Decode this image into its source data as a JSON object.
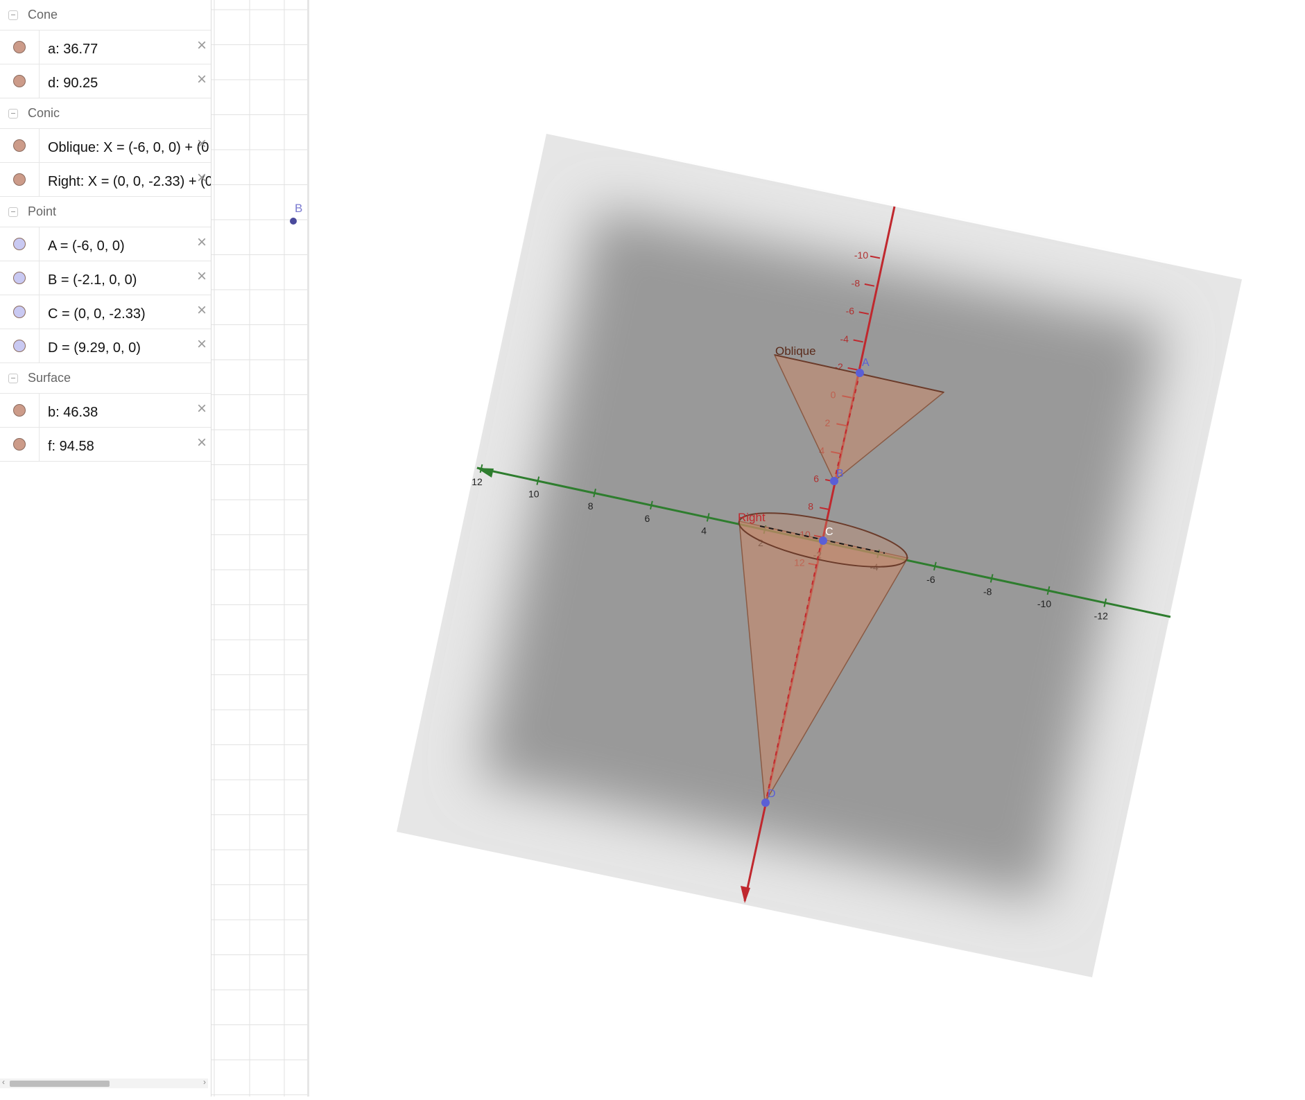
{
  "algebra": {
    "groups": [
      {
        "title": "Cone",
        "items": [
          {
            "text": "a: 36.77",
            "marble_color": "#cc9b89"
          },
          {
            "text": "d: 90.25",
            "marble_color": "#cc9b89"
          }
        ]
      },
      {
        "title": "Conic",
        "items": [
          {
            "text": "Oblique: X = (-6, 0, 0) + (0",
            "marble_color": "#cc9b89"
          },
          {
            "text": "Right: X = (0, 0, -2.33) + (0",
            "marble_color": "#cc9b89"
          }
        ]
      },
      {
        "title": "Point",
        "items": [
          {
            "text": "A = (-6, 0, 0)",
            "marble_color": "#c9c9f2"
          },
          {
            "text": "B = (-2.1, 0, 0)",
            "marble_color": "#c9c9f2"
          },
          {
            "text": "C = (0, 0, -2.33)",
            "marble_color": "#c9c9f2"
          },
          {
            "text": "D = (9.29, 0, 0)",
            "marble_color": "#c9c9f2"
          }
        ]
      },
      {
        "title": "Surface",
        "items": [
          {
            "text": "b: 46.38",
            "marble_color": "#cc9b89"
          },
          {
            "text": "f: 94.58",
            "marble_color": "#cc9b89"
          }
        ]
      }
    ],
    "delete_glyph": "×"
  },
  "graphics2d": {
    "point_label": "B",
    "point_color": "#4a4a9c"
  },
  "view3d": {
    "red_axis_ticks": [
      "-10",
      "-8",
      "-6",
      "-4",
      "-2",
      "0",
      "2",
      "4",
      "6",
      "8",
      "10",
      "12"
    ],
    "green_axis_ticks": [
      "12",
      "10",
      "8",
      "6",
      "4",
      "2",
      "-2",
      "-4",
      "-6",
      "-8",
      "-10",
      "-12"
    ],
    "labels": {
      "oblique": "Oblique",
      "right": "Right",
      "A": "A",
      "B": "B",
      "C": "C",
      "D": "D"
    },
    "colors": {
      "red_axis": "#c0282e",
      "green_axis": "#2e7d2e",
      "cone_fill": "#c8896a",
      "point": "#5a5fd6",
      "plane": "#9c9c9c"
    }
  }
}
